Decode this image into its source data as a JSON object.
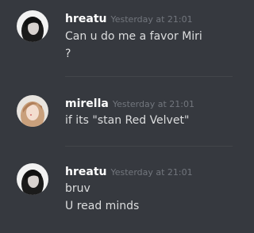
{
  "messages": [
    {
      "username": "hreatu",
      "timestamp": "Yesterday at 21:01",
      "lines": [
        "Can u do me a favor Miri",
        "?"
      ],
      "avatar": "user-avatar-dark"
    },
    {
      "username": "mirella",
      "timestamp": "Yesterday at 21:01",
      "lines": [
        "if its \"stan Red Velvet\""
      ],
      "avatar": "user-avatar-light"
    },
    {
      "username": "hreatu",
      "timestamp": "Yesterday at 21:01",
      "lines": [
        "bruv",
        "U read minds"
      ],
      "avatar": "user-avatar-dark"
    }
  ],
  "colors": {
    "background": "#36393f",
    "username": "#ffffff",
    "timestamp": "#72767d",
    "message_text": "#dcddde",
    "divider": "#42454a"
  }
}
